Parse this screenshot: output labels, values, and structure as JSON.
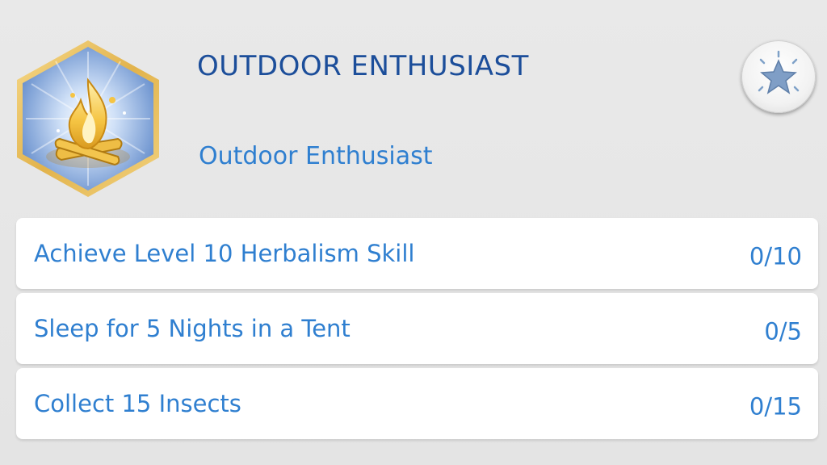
{
  "aspiration": {
    "title": "Outdoor Enthusiast",
    "subtitle": "Outdoor Enthusiast",
    "icon": "campfire-icon"
  },
  "star_button": {
    "icon": "star-icon"
  },
  "goals": [
    {
      "label": "Achieve Level 10 Herbalism Skill",
      "progress": "0/10"
    },
    {
      "label": "Sleep for 5 Nights in a Tent",
      "progress": "0/5"
    },
    {
      "label": "Collect 15 Insects",
      "progress": "0/15"
    }
  ],
  "colors": {
    "title": "#1c4e9a",
    "text": "#2f7fd0",
    "badge_border": "#e9c15a",
    "flame": "#f3c244"
  }
}
